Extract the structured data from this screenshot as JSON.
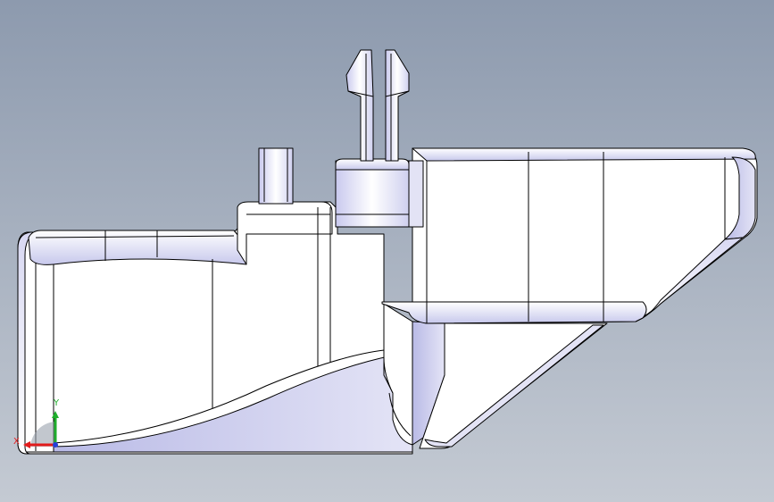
{
  "viewport": {
    "background_top": "#8d9aae",
    "background_bottom": "#c4cad3"
  },
  "model": {
    "face_color": "#ffffff",
    "shade_color": "#c6c7ea",
    "edge_color": "#000000"
  },
  "triad": {
    "x_label": "X",
    "y_label": "Y",
    "x_color": "#e21b1b",
    "y_color": "#1fae2c",
    "z_color": "#2540d8"
  }
}
